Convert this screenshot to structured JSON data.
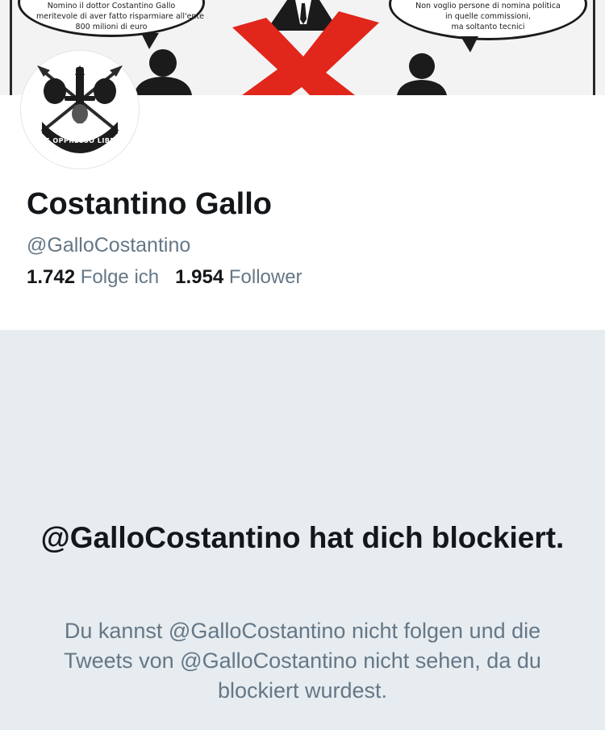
{
  "banner": {
    "bubble_left": [
      "Nomino il dottor Costantino Gallo",
      "meritevole di aver fatto risparmiare all'ente",
      "800 milioni di euro"
    ],
    "bubble_right": [
      "Non voglio persone di nomina politica",
      "in quelle commissioni,",
      "ma soltanto tecnici"
    ]
  },
  "avatar": {
    "badge_text": "DE OPPRESSO LIBER"
  },
  "profile": {
    "name": "Costantino Gallo",
    "handle": "@GalloCostantino",
    "following_count": "1.742",
    "following_label": "Folge ich",
    "followers_count": "1.954",
    "followers_label": "Follower"
  },
  "blocked": {
    "title": "@GalloCostantino hat dich blockiert.",
    "message": "Du kannst @GalloCostantino nicht folgen und die Tweets von @GalloCostantino nicht sehen, da du blockiert wurdest."
  },
  "colors": {
    "text_primary": "#14171a",
    "text_secondary": "#657786",
    "panel_background": "#e6ecf0",
    "banner_red": "#e1261c"
  }
}
